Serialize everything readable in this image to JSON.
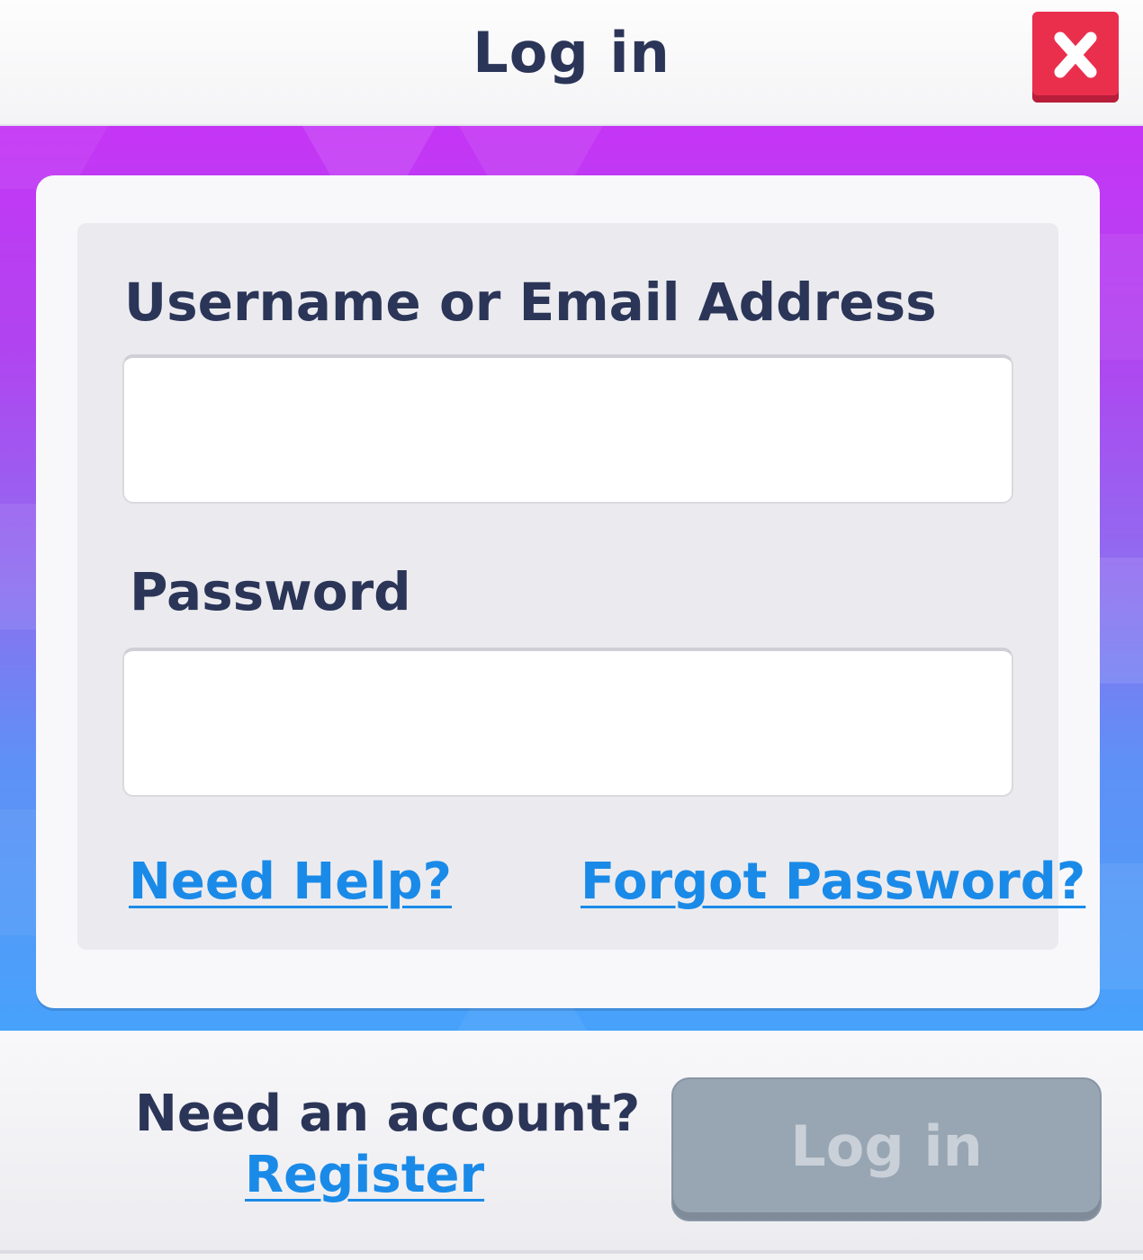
{
  "header": {
    "title": "Log in",
    "close_icon": "close-icon"
  },
  "form": {
    "username_label": "Username or Email Address",
    "username_value": "",
    "password_label": "Password",
    "password_value": "",
    "need_help_link": "Need Help?",
    "forgot_password_link": "Forgot Password?"
  },
  "footer": {
    "need_account_text": "Need an account?",
    "register_link": "Register",
    "login_button_label": "Log in",
    "login_button_state": "disabled"
  },
  "colors": {
    "title_text": "#2b3558",
    "link": "#1a8ae8",
    "close_button": "#ea2f4d",
    "background_top": "#c535f5",
    "background_bottom": "#47a2fb",
    "disabled_button": "#98a5b3"
  }
}
